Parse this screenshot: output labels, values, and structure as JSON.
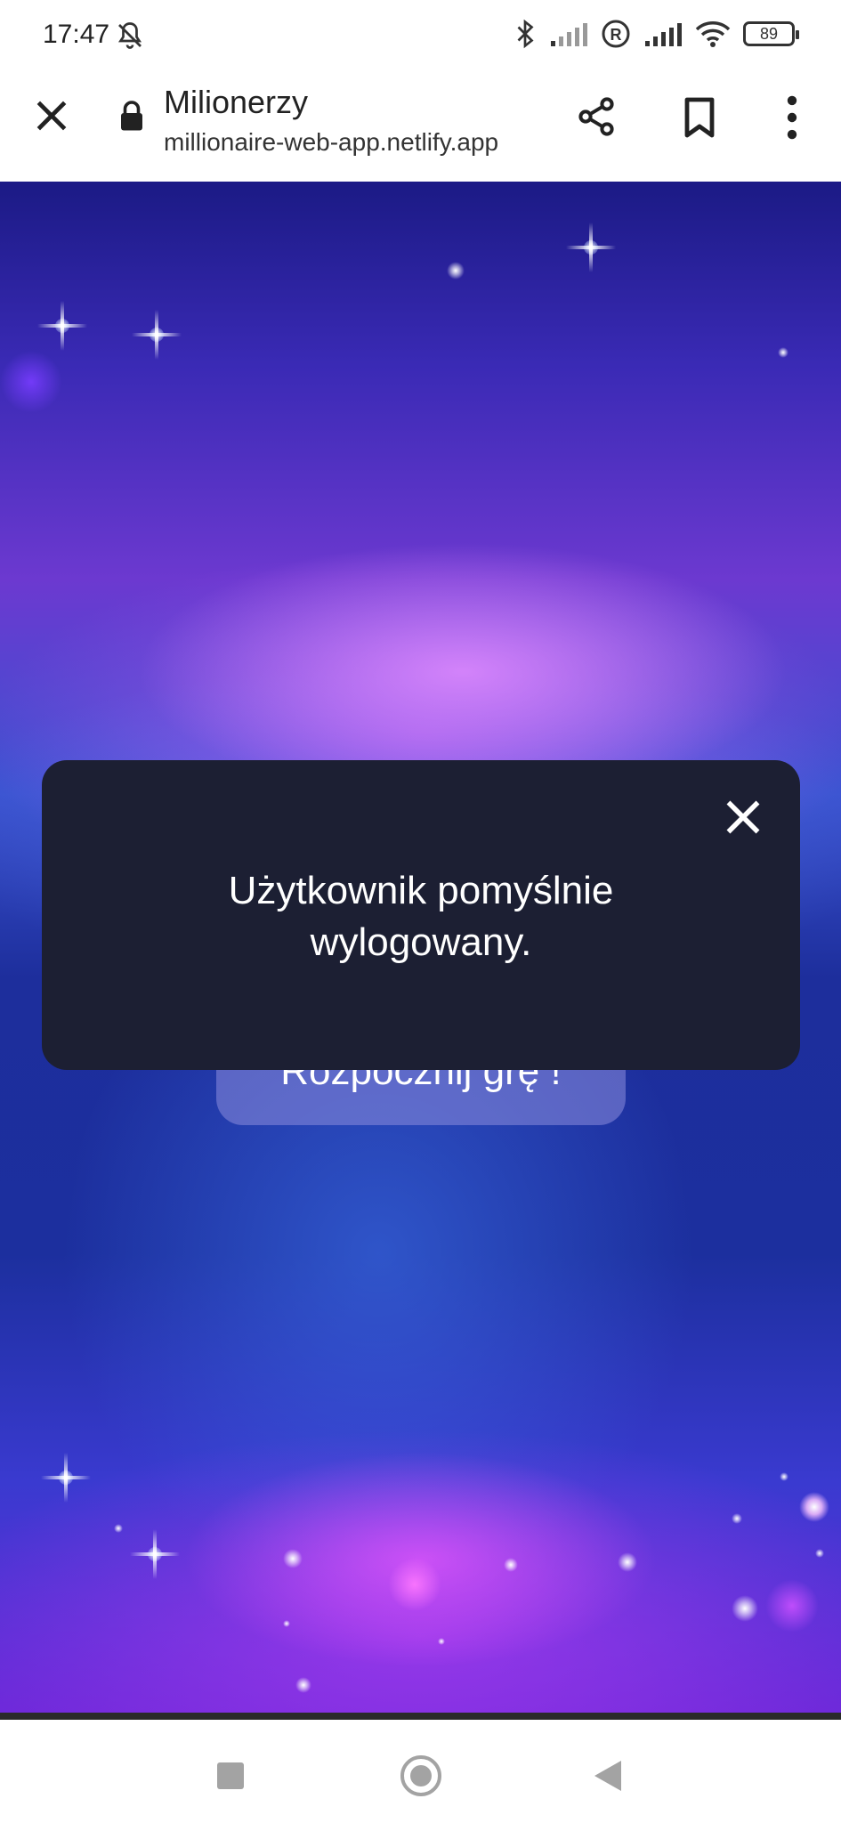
{
  "status_bar": {
    "time": "17:47",
    "battery": "89",
    "icons": [
      "bell-off-icon",
      "bluetooth-icon",
      "signal-icon",
      "roaming-icon",
      "signal-icon",
      "wifi-icon",
      "battery-icon"
    ]
  },
  "browser": {
    "title": "Milionerzy",
    "url": "millionaire-web-app.netlify.app"
  },
  "page": {
    "start_button": "Rozpocznij grę !"
  },
  "dialog": {
    "message_line1": "Użytkownik pomyślnie",
    "message_line2": "wylogowany."
  },
  "colors": {
    "dialog_bg": "#1c1f33",
    "nav_icon": "#a3a3a3"
  }
}
